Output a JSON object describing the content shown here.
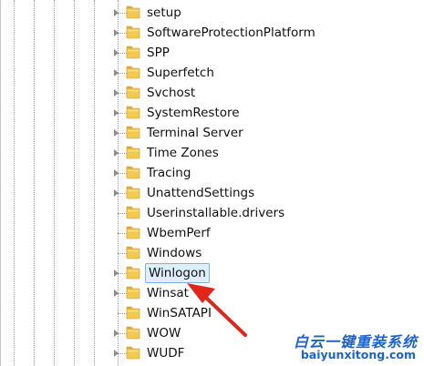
{
  "tree": {
    "items": [
      {
        "label": "setup",
        "expandable": true,
        "selected": false
      },
      {
        "label": "SoftwareProtectionPlatform",
        "expandable": true,
        "selected": false
      },
      {
        "label": "SPP",
        "expandable": true,
        "selected": false
      },
      {
        "label": "Superfetch",
        "expandable": true,
        "selected": false
      },
      {
        "label": "Svchost",
        "expandable": true,
        "selected": false
      },
      {
        "label": "SystemRestore",
        "expandable": true,
        "selected": false
      },
      {
        "label": "Terminal Server",
        "expandable": true,
        "selected": false
      },
      {
        "label": "Time Zones",
        "expandable": true,
        "selected": false
      },
      {
        "label": "Tracing",
        "expandable": true,
        "selected": false
      },
      {
        "label": "UnattendSettings",
        "expandable": true,
        "selected": false
      },
      {
        "label": "Userinstallable.drivers",
        "expandable": false,
        "selected": false
      },
      {
        "label": "WbemPerf",
        "expandable": false,
        "selected": false
      },
      {
        "label": "Windows",
        "expandable": false,
        "selected": false
      },
      {
        "label": "Winlogon",
        "expandable": true,
        "selected": true
      },
      {
        "label": "Winsat",
        "expandable": true,
        "selected": false
      },
      {
        "label": "WinSATAPI",
        "expandable": false,
        "selected": false
      },
      {
        "label": "WOW",
        "expandable": true,
        "selected": false
      },
      {
        "label": "WUDF",
        "expandable": true,
        "selected": false
      }
    ]
  },
  "colors": {
    "folder_body": "#f3c94f",
    "folder_tab": "#e6b23a",
    "folder_edge": "#c9962a",
    "selection_bg": "#dfeefc",
    "selection_border": "#7fb2e6",
    "arrow": "#e0251b",
    "watermark": "#1f63c6"
  },
  "annotation": {
    "icon": "red-arrow-icon"
  },
  "watermark": {
    "chinese": "白云一键重装系统",
    "url": "baiyunxitong.com"
  }
}
